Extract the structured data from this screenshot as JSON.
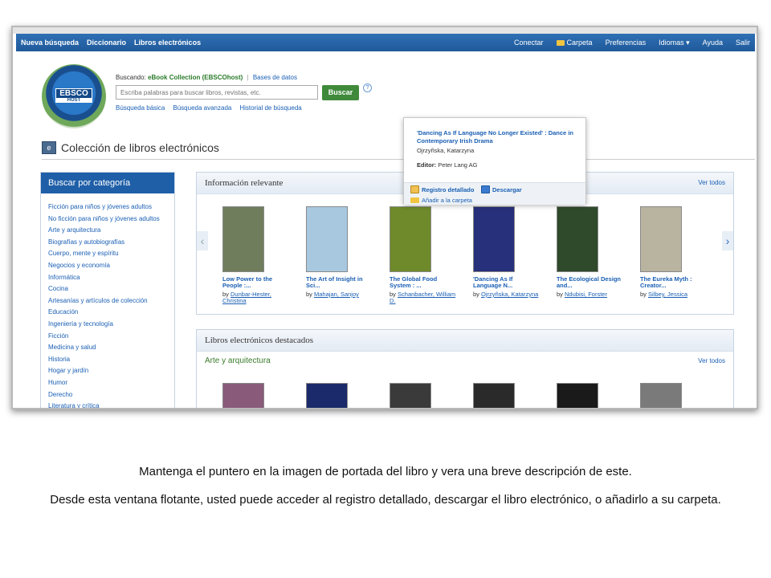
{
  "nav": {
    "left": [
      "Nueva búsqueda",
      "Diccionario",
      "Libros electrónicos"
    ],
    "right": [
      "Conectar",
      "Carpeta",
      "Preferencias",
      "Idiomas ▾",
      "Ayuda",
      "Salir"
    ]
  },
  "logo": {
    "top": "EBSCO",
    "bottom": "HOST"
  },
  "search": {
    "prefix": "Buscando:",
    "collection": "eBook Collection (EBSCOhost)",
    "sep": "|",
    "databases": "Bases de datos",
    "placeholder": "Escriba palabras para buscar libros, revistas, etc.",
    "button": "Buscar",
    "help": "?",
    "links": [
      "Búsqueda básica",
      "Búsqueda avanzada",
      "Historial de búsqueda"
    ]
  },
  "page_title": "Colección de libros electrónicos",
  "sidebar": {
    "header": "Buscar por categoría",
    "items": [
      "Ficción para niños y jóvenes adultos",
      "No ficción para niños y jóvenes adultos",
      "Arte y arquitectura",
      "Biografías y autobiografías",
      "Cuerpo, mente y espíritu",
      "Negocios y economía",
      "Informática",
      "Cocina",
      "Artesanías y artículos de colección",
      "Educación",
      "Ingeniería y tecnología",
      "Ficción",
      "Medicina y salud",
      "Historia",
      "Hogar y jardín",
      "Humor",
      "Derecho",
      "Literatura y crítica"
    ]
  },
  "relevant": {
    "title": "Información relevante",
    "see_all": "Ver todos",
    "prev": "‹",
    "next": "›",
    "books": [
      {
        "title1": "Low Power to the",
        "title2": "People :...",
        "by": "by",
        "a1": "Dunbar-Hester,",
        "a2": "Christina",
        "color": "#6f7d5c"
      },
      {
        "title1": "The Art of Insight in",
        "title2": "Sci...",
        "by": "by",
        "a1": "Mahajan, Sanjoy",
        "a2": "",
        "color": "#a8c8e0"
      },
      {
        "title1": "The Global Food",
        "title2": "System : ...",
        "by": "by",
        "a1": "Schanbacher, William",
        "a2": "D.",
        "color": "#6e8a2a"
      },
      {
        "title1": "'Dancing As If",
        "title2": "Language N...",
        "by": "by",
        "a1": "Ojrzyñska, Katarzyna",
        "a2": "",
        "color": "#27307a"
      },
      {
        "title1": "The Ecological Design",
        "title2": "and...",
        "by": "by",
        "a1": "Ndubisi, Forster",
        "a2": "",
        "color": "#2f4a2a"
      },
      {
        "title1": "The Eureka Myth :",
        "title2": "Creator...",
        "by": "by",
        "a1": "Silbey, Jessica",
        "a2": "",
        "color": "#b8b4a0"
      }
    ]
  },
  "featured": {
    "title": "Libros electrónicos destacados",
    "subtitle": "Arte y arquitectura",
    "see_all": "Ver todos",
    "colors": [
      "#8a5a7a",
      "#1a2a6a",
      "#3a3a3a",
      "#2a2a2a",
      "#1a1a1a",
      "#7a7a7a"
    ]
  },
  "popup": {
    "title": "'Dancing As If Language No Longer Existed' : Dance in Contemporary Irish Drama",
    "author": "Ojrzyñska, Katarzyna",
    "publisher_label": "Editor:",
    "publisher": "Peter Lang AG",
    "detail": "Registro detallado",
    "download": "Descargar",
    "add": "Añadir a la carpeta"
  },
  "caption": {
    "line1": "Mantenga el puntero en la imagen de portada del libro y vera una breve descripción de este.",
    "line2": "Desde esta ventana flotante, usted puede acceder al registro detallado, descargar el libro electrónico, o añadirlo a su carpeta."
  }
}
